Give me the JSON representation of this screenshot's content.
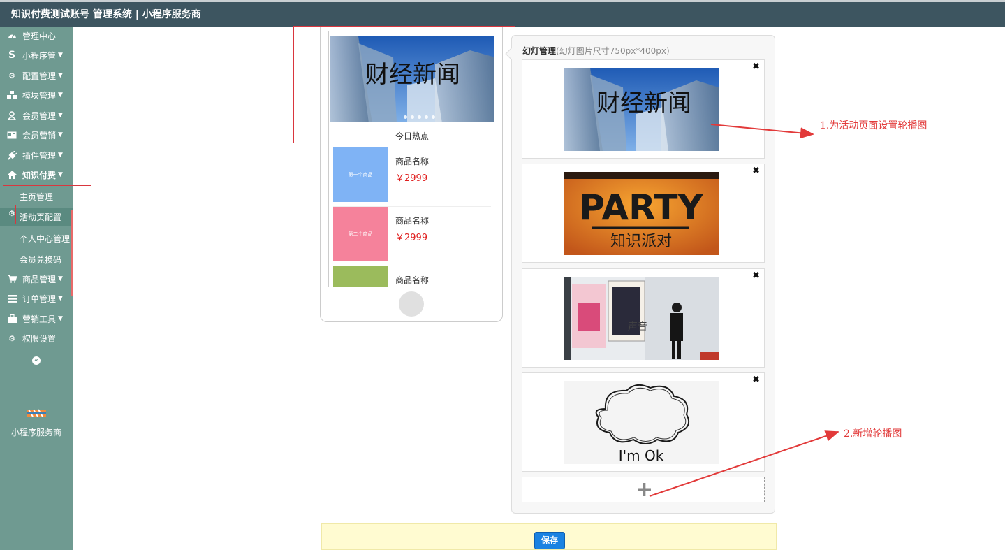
{
  "app": {
    "title": "知识付费测试账号 管理系统 | 小程序服务商"
  },
  "sidebar": {
    "items": [
      {
        "label": "管理中心",
        "icon": "dashboard-icon",
        "chevron": false
      },
      {
        "label": "小程序管",
        "icon": "s-logo-icon",
        "chevron": true
      },
      {
        "label": "配置管理",
        "icon": "gears-icon",
        "chevron": true
      },
      {
        "label": "模块管理",
        "icon": "cubes-icon",
        "chevron": true
      },
      {
        "label": "会员管理",
        "icon": "user-icon",
        "chevron": true
      },
      {
        "label": "会员营销",
        "icon": "id-card-icon",
        "chevron": true
      },
      {
        "label": "插件管理",
        "icon": "plug-icon",
        "chevron": true
      },
      {
        "label": "知识付费",
        "icon": "home-icon",
        "chevron": true
      }
    ],
    "subitems": [
      "主页管理",
      "活动页配置",
      "个人中心管理",
      "会员兑换码"
    ],
    "items_bottom": [
      {
        "label": "商品管理",
        "icon": "cart-icon",
        "chevron": true
      },
      {
        "label": "订单管理",
        "icon": "list-icon",
        "chevron": true
      },
      {
        "label": "营销工具",
        "icon": "briefcase-icon",
        "chevron": true
      },
      {
        "label": "权限设置",
        "icon": "gear-icon",
        "chevron": false
      }
    ],
    "collapse_glyph": "«",
    "brand": "小程序服务商"
  },
  "preview": {
    "banner_text": "财经新闻",
    "section_title": "今日热点",
    "products": [
      {
        "thumb": "第一个商品",
        "name": "商品名称",
        "price": "￥2999",
        "color": "#7fb3f5"
      },
      {
        "thumb": "第二个商品",
        "name": "商品名称",
        "price": "￥2999",
        "color": "#f5829b"
      },
      {
        "thumb": "",
        "name": "商品名称",
        "price": "",
        "color": "#9bbb5c"
      }
    ]
  },
  "slides_panel": {
    "title": "幻灯管理",
    "subtitle": "(幻灯图片尺寸750px*400px)",
    "close_glyph": "✖",
    "slides": [
      {
        "kind": "finance",
        "text": "财经新闻"
      },
      {
        "kind": "party",
        "text_top": "PARTY",
        "text_bottom": "知识派对"
      },
      {
        "kind": "photo",
        "text": "声音"
      },
      {
        "kind": "cloud",
        "text": "I'm  Ok"
      }
    ],
    "add_glyph": "+"
  },
  "footer": {
    "save_label": "保存"
  },
  "annotations": {
    "first": "1.为活动页面设置轮播图",
    "second": "2.新增轮播图"
  },
  "colors": {
    "topbar": "#3d5560",
    "sidebar": "#6f9a91",
    "accent_red": "#e23a3a",
    "save_button": "#1a82e2"
  }
}
